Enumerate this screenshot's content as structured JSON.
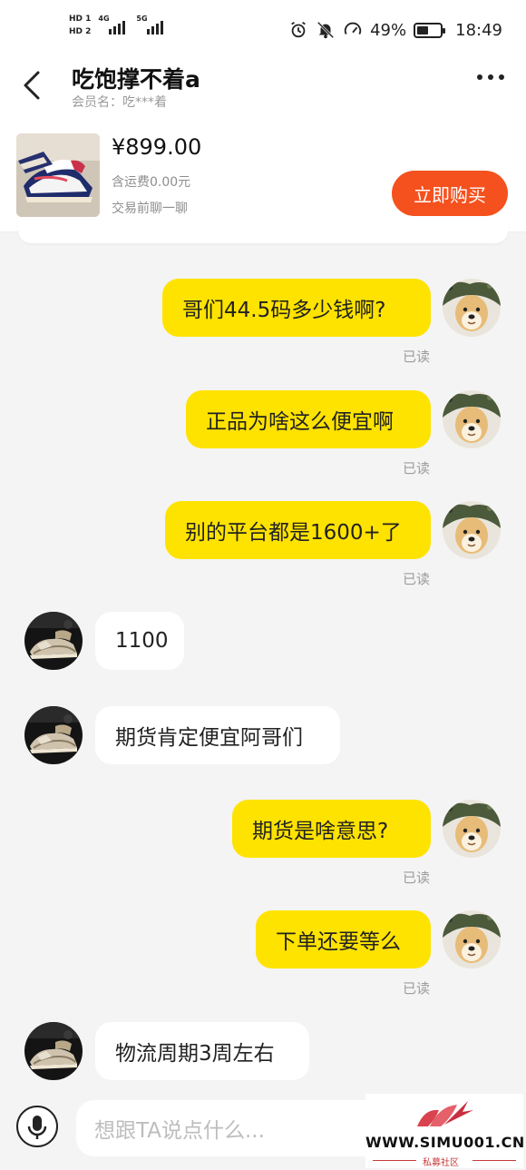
{
  "status_bar": {
    "hd1": "HD 1",
    "hd2": "HD 2",
    "net1": "4G",
    "net2": "5G",
    "battery_pct": "49%",
    "battery_level": 0.49,
    "time": "18:49"
  },
  "header": {
    "title": "吃饱撑不着a",
    "subtitle": "会员名：吃***着"
  },
  "product": {
    "price": "¥899.00",
    "shipping": "含运费0.00元",
    "note": "交易前聊一聊",
    "buy_label": "立即购买"
  },
  "messages": [
    {
      "dir": "out",
      "text": "哥们44.5码多少钱啊?",
      "status": "已读"
    },
    {
      "dir": "out",
      "text": "正品为啥这么便宜啊",
      "status": "已读"
    },
    {
      "dir": "out",
      "text": "别的平台都是1600+了",
      "status": "已读"
    },
    {
      "dir": "in",
      "text": "1100"
    },
    {
      "dir": "in",
      "text": "期货肯定便宜阿哥们"
    },
    {
      "dir": "out",
      "text": "期货是啥意思?",
      "status": "已读"
    },
    {
      "dir": "out",
      "text": "下单还要等么",
      "status": "已读"
    },
    {
      "dir": "in",
      "text": "物流周期3周左右"
    }
  ],
  "input": {
    "placeholder": "想跟TA说点什么..."
  },
  "watermark": {
    "text": "WWW.SIMU001.CN",
    "sub": "私募社区"
  },
  "colors": {
    "outgoing_bubble": "#ffe300",
    "buy_button": "#f4511e",
    "background": "#f4f4f4"
  }
}
